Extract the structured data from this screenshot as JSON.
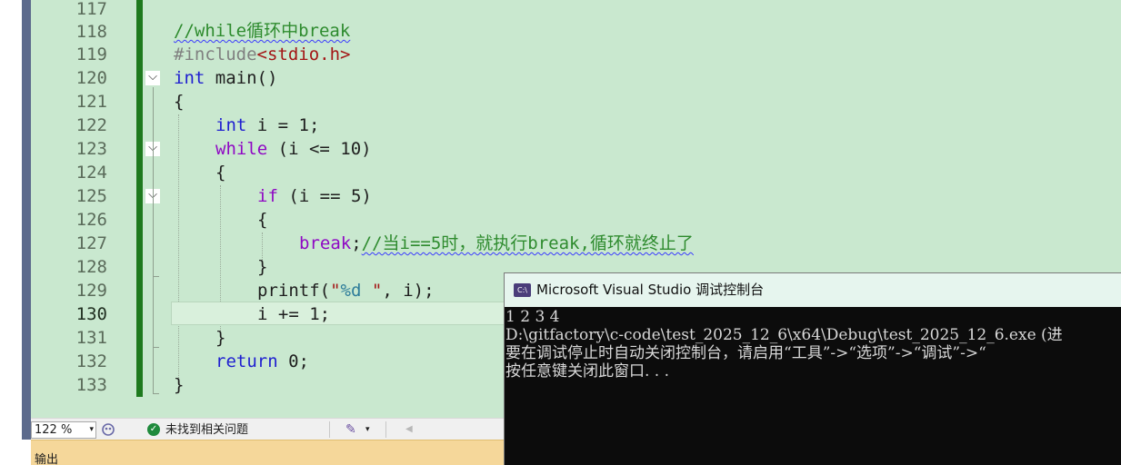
{
  "editor": {
    "line_numbers": [
      "117",
      "118",
      "119",
      "120",
      "121",
      "122",
      "123",
      "124",
      "125",
      "126",
      "127",
      "128",
      "129",
      "130",
      "131",
      "132",
      "133"
    ],
    "code": {
      "l118_comment": "//while循环中break",
      "l119_pp": "#include",
      "l119_inc": "<stdio.h>",
      "l120_kw": "int",
      "l120_rest": " main()",
      "l121": "{",
      "l122_kw": "int",
      "l122_rest": " i = 1;",
      "l123_kw": "while",
      "l123_rest": " (i <= 10)",
      "l124": "{",
      "l125_kw": "if",
      "l125_rest": " (i == 5)",
      "l126": "{",
      "l127_kw": "break",
      "l127_semi": ";",
      "l127_comment": "//当i==5时，就执行break,循环就终止了",
      "l128": "}",
      "l129_fn": "printf(",
      "l129_str_open": "\"",
      "l129_fmt": "%d",
      "l129_str_close": " \"",
      "l129_rest": ", i);",
      "l130": "i += 1;",
      "l131": "}",
      "l132_kw": "return",
      "l132_rest": " 0;",
      "l133": "}"
    },
    "fold_symbol": "⌵"
  },
  "statusbar": {
    "zoom": "122 %",
    "zoom_arrow": "▾",
    "issues_label": "未找到相关问题",
    "issues_check": "✓",
    "brush_glyph": "✎",
    "brush_arrow": "▾",
    "scroll_left": "◀"
  },
  "output_panel": {
    "title": "输出"
  },
  "console": {
    "icon_text": "C:\\",
    "title": "Microsoft Visual Studio 调试控制台",
    "lines": [
      "1 2 3 4",
      "D:\\gitfactory\\c-code\\test_2025_12_6\\x64\\Debug\\test_2025_12_6.exe (进",
      "要在调试停止时自动关闭控制台，请启用“工具”->“选项”->“调试”->“",
      "按任意键关闭此窗口. . ."
    ]
  }
}
